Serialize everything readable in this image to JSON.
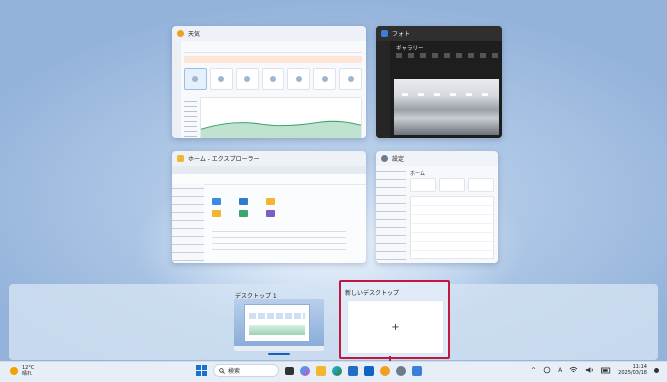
{
  "windows": {
    "weather": {
      "title": "天気"
    },
    "photos": {
      "title": "フォト",
      "gallery_label": "ギャラリー"
    },
    "explorer": {
      "title": "ホーム - エクスプローラー"
    },
    "settings": {
      "title": "設定",
      "page": "ホーム"
    }
  },
  "desktops": {
    "desktop1": {
      "label": "デスクトップ 1"
    },
    "new_desktop": {
      "label": "新しいデスクトップ",
      "add_symbol": "+"
    }
  },
  "taskbar": {
    "weather": {
      "temp": "12°C",
      "condition": "晴れ"
    },
    "search_placeholder": "検索",
    "tray": {
      "chevron": "^",
      "ime": "A"
    },
    "clock": {
      "time": "11:14",
      "date": "2025/03/18"
    }
  },
  "colors": {
    "accent": "#1870d0",
    "highlight": "#c0183f"
  }
}
